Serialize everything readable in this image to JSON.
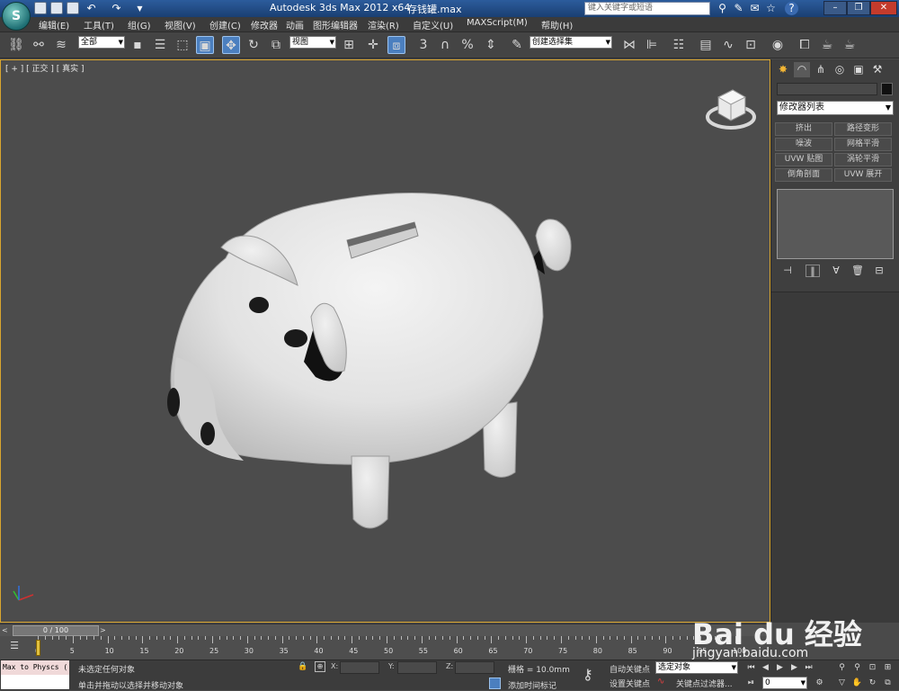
{
  "title_bar": {
    "app_title": "Autodesk 3ds Max  2012 x64",
    "file_name": "存钱罐.max",
    "search_placeholder": "键入关键字或短语",
    "app_button": "S"
  },
  "menu": {
    "items": [
      "编辑(E)",
      "工具(T)",
      "组(G)",
      "视图(V)",
      "创建(C)",
      "修改器",
      "动画",
      "图形编辑器",
      "渲染(R)",
      "自定义(U)",
      "MAXScript(M)",
      "帮助(H)"
    ]
  },
  "toolbar": {
    "selection_filter": "全部",
    "reference_coord": "视图",
    "snap_3": "3",
    "named_selection_sets": "创建选择集"
  },
  "viewport": {
    "label": "[ + ] [ 正交 ] [ 真实 ]",
    "model": "piggy-bank"
  },
  "command_panel": {
    "modifier_list": "修改器列表",
    "modifier_buttons": [
      "挤出",
      "路径变形",
      "噪波",
      "网格平滑",
      "UVW 贴图",
      "涡轮平滑",
      "倒角剖面",
      "UVW 展开"
    ]
  },
  "time_slider": {
    "frame_display": "0 / 100",
    "ticks": [
      "0",
      "5",
      "10",
      "15",
      "20",
      "25",
      "30",
      "35",
      "40",
      "45",
      "50",
      "55",
      "60",
      "65",
      "70",
      "75",
      "80",
      "85",
      "90",
      "95",
      "100"
    ]
  },
  "status_bar": {
    "maxscript_listener": "Max to Physcs (",
    "selection_status": "未选定任何对象",
    "prompt": "单击并拖动以选择并移动对象",
    "x_label": "X:",
    "y_label": "Y:",
    "z_label": "Z:",
    "grid": "栅格 = 10.0mm",
    "add_time_tag": "添加时间标记",
    "auto_key": "自动关键点",
    "set_key": "设置关键点",
    "selected_object": "选定对象",
    "key_filters": "关键点过滤器...",
    "current_frame": "0"
  },
  "watermark": {
    "brand": "Bai du 经验",
    "url": "jingyan.baidu.com"
  },
  "colors": {
    "viewport_border": "#d9a62e",
    "title_bar": "#1a3f72",
    "active_tool": "#4b7fbf"
  }
}
